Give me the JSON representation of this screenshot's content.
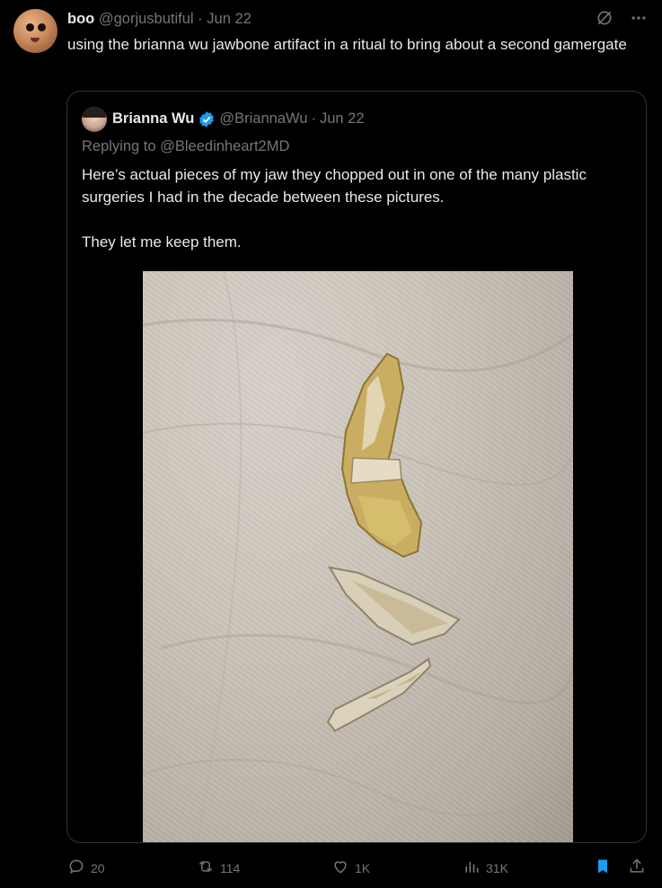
{
  "tweet": {
    "display_name": "boo",
    "handle": "@gorjusbutiful",
    "separator": "·",
    "date": "Jun 22",
    "text": "using the brianna wu jawbone artifact in a ritual to bring about a second gamergate"
  },
  "quoted": {
    "display_name": "Brianna Wu",
    "handle": "@BriannaWu",
    "separator": "·",
    "date": "Jun 22",
    "replying_to": "Replying to @Bleedinheart2MD",
    "paragraph1": "Here’s actual pieces of my jaw they chopped out in one of the many plastic surgeries I had in the decade between these pictures.",
    "paragraph2": "They let me keep them."
  },
  "actions": {
    "replies": "20",
    "reposts": "114",
    "likes": "1K",
    "views": "31K"
  },
  "colors": {
    "background": "#000000",
    "text": "#e7e9ea",
    "muted": "#71767b",
    "border": "#2f3336",
    "accent": "#1d9bf0"
  },
  "icons": {
    "grok": "grok-icon",
    "more": "more-icon",
    "verified": "verified-badge-icon",
    "reply": "reply-icon",
    "repost": "repost-icon",
    "like": "like-icon",
    "views": "views-icon",
    "bookmark": "bookmark-icon",
    "share": "share-icon"
  }
}
